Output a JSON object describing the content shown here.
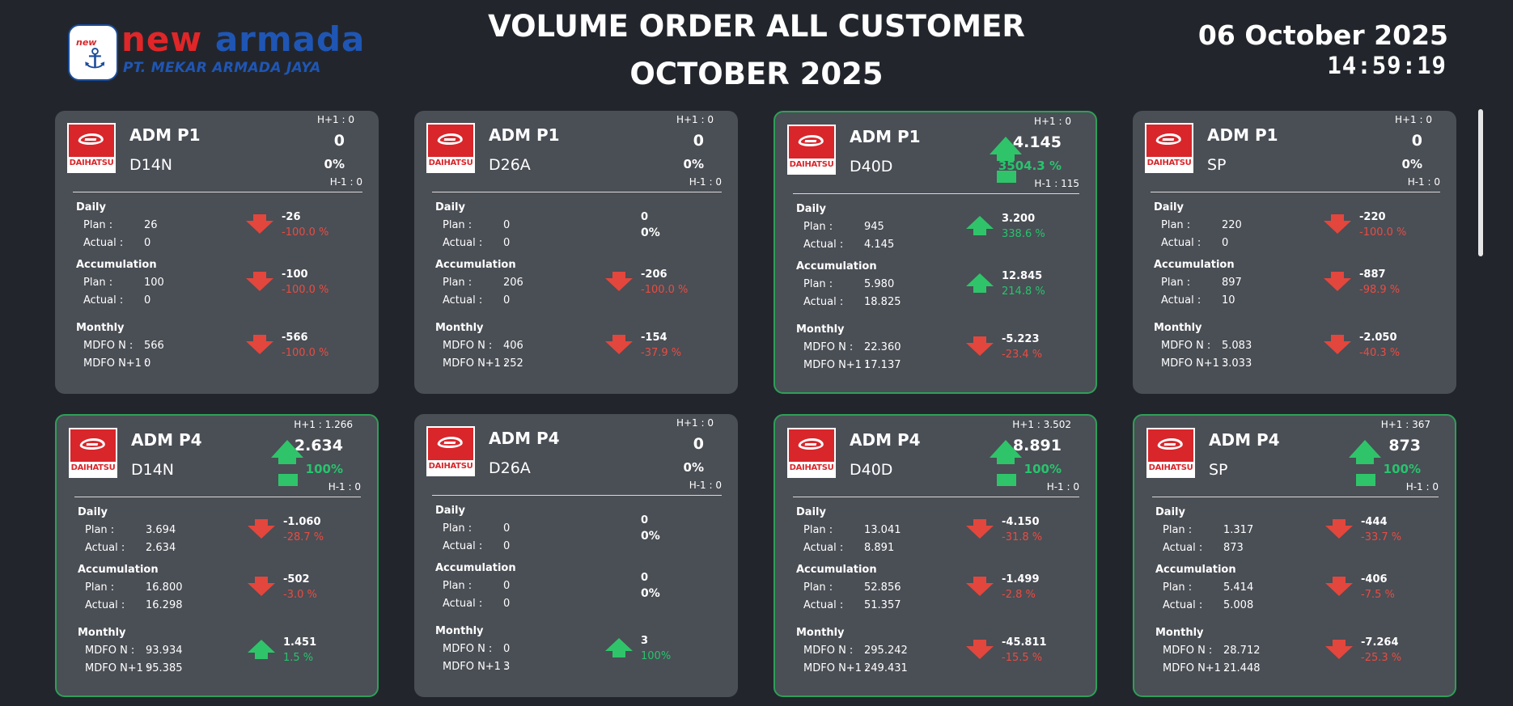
{
  "header": {
    "logo_mini": "new",
    "logo_name_1": "new",
    "logo_name_2": "armada",
    "logo_sub": "PT. MEKAR ARMADA JAYA",
    "title_line1": "VOLUME ORDER ALL CUSTOMER",
    "title_line2": "OCTOBER 2025",
    "date": "06 October 2025",
    "time": "14:59:19"
  },
  "labels": {
    "brand": "DAIHATSU",
    "daily": "Daily",
    "accumulation": "Accumulation",
    "monthly": "Monthly",
    "plan": "Plan :",
    "actual": "Actual :",
    "mdfo_n": "MDFO N :",
    "mdfo_n1": "MDFO N+1 :"
  },
  "colors": {
    "background": "#22262c",
    "card": "#4a4e55",
    "up": "#2fc46a",
    "down": "#e3463c",
    "highlight_border": "#2f9f58"
  },
  "cards": [
    {
      "customer": "ADM P1",
      "part": "D14N",
      "h_plus": "H+1 : 0",
      "h_minus": "H-1 : 0",
      "value": "0",
      "value_pct": "0%",
      "trend": "none",
      "daily": {
        "plan": "26",
        "actual": "0",
        "diff": "-26",
        "pct": "-100.0 %",
        "dir": "down"
      },
      "accum": {
        "plan": "100",
        "actual": "0",
        "diff": "-100",
        "pct": "-100.0 %",
        "dir": "down"
      },
      "monthly": {
        "mdfo_n": "566",
        "mdfo_n1": "0",
        "diff": "-566",
        "pct": "-100.0 %",
        "dir": "down"
      }
    },
    {
      "customer": "ADM P1",
      "part": "D26A",
      "h_plus": "H+1 : 0",
      "h_minus": "H-1 : 0",
      "value": "0",
      "value_pct": "0%",
      "trend": "none",
      "daily": {
        "plan": "0",
        "actual": "0",
        "diff": "0",
        "pct": "0%",
        "dir": "none"
      },
      "accum": {
        "plan": "206",
        "actual": "0",
        "diff": "-206",
        "pct": "-100.0 %",
        "dir": "down"
      },
      "monthly": {
        "mdfo_n": "406",
        "mdfo_n1": "252",
        "diff": "-154",
        "pct": "-37.9 %",
        "dir": "down"
      }
    },
    {
      "customer": "ADM P1",
      "part": "D40D",
      "h_plus": "H+1 : 0",
      "h_minus": "H-1 : 115",
      "value": "4.145",
      "value_pct": "3504.3 %",
      "trend": "up",
      "daily": {
        "plan": "945",
        "actual": "4.145",
        "diff": "3.200",
        "pct": "338.6 %",
        "dir": "up"
      },
      "accum": {
        "plan": "5.980",
        "actual": "18.825",
        "diff": "12.845",
        "pct": "214.8 %",
        "dir": "up"
      },
      "monthly": {
        "mdfo_n": "22.360",
        "mdfo_n1": "17.137",
        "diff": "-5.223",
        "pct": "-23.4 %",
        "dir": "down"
      }
    },
    {
      "customer": "ADM P1",
      "part": "SP",
      "h_plus": "H+1 : 0",
      "h_minus": "H-1 : 0",
      "value": "0",
      "value_pct": "0%",
      "trend": "none",
      "daily": {
        "plan": "220",
        "actual": "0",
        "diff": "-220",
        "pct": "-100.0 %",
        "dir": "down"
      },
      "accum": {
        "plan": "897",
        "actual": "10",
        "diff": "-887",
        "pct": "-98.9 %",
        "dir": "down"
      },
      "monthly": {
        "mdfo_n": "5.083",
        "mdfo_n1": "3.033",
        "diff": "-2.050",
        "pct": "-40.3 %",
        "dir": "down"
      }
    },
    {
      "customer": "ADM P4",
      "part": "D14N",
      "h_plus": "H+1 : 1.266",
      "h_minus": "H-1 : 0",
      "value": "2.634",
      "value_pct": "100%",
      "trend": "up",
      "daily": {
        "plan": "3.694",
        "actual": "2.634",
        "diff": "-1.060",
        "pct": "-28.7 %",
        "dir": "down"
      },
      "accum": {
        "plan": "16.800",
        "actual": "16.298",
        "diff": "-502",
        "pct": "-3.0 %",
        "dir": "down"
      },
      "monthly": {
        "mdfo_n": "93.934",
        "mdfo_n1": "95.385",
        "diff": "1.451",
        "pct": "1.5 %",
        "dir": "up"
      }
    },
    {
      "customer": "ADM P4",
      "part": "D26A",
      "h_plus": "H+1 : 0",
      "h_minus": "H-1 : 0",
      "value": "0",
      "value_pct": "0%",
      "trend": "none",
      "daily": {
        "plan": "0",
        "actual": "0",
        "diff": "0",
        "pct": "0%",
        "dir": "none"
      },
      "accum": {
        "plan": "0",
        "actual": "0",
        "diff": "0",
        "pct": "0%",
        "dir": "none"
      },
      "monthly": {
        "mdfo_n": "0",
        "mdfo_n1": "3",
        "diff": "3",
        "pct": "100%",
        "dir": "up"
      }
    },
    {
      "customer": "ADM P4",
      "part": "D40D",
      "h_plus": "H+1 : 3.502",
      "h_minus": "H-1 : 0",
      "value": "8.891",
      "value_pct": "100%",
      "trend": "up",
      "daily": {
        "plan": "13.041",
        "actual": "8.891",
        "diff": "-4.150",
        "pct": "-31.8 %",
        "dir": "down"
      },
      "accum": {
        "plan": "52.856",
        "actual": "51.357",
        "diff": "-1.499",
        "pct": "-2.8 %",
        "dir": "down"
      },
      "monthly": {
        "mdfo_n": "295.242",
        "mdfo_n1": "249.431",
        "diff": "-45.811",
        "pct": "-15.5 %",
        "dir": "down"
      }
    },
    {
      "customer": "ADM P4",
      "part": "SP",
      "h_plus": "H+1 : 367",
      "h_minus": "H-1 : 0",
      "value": "873",
      "value_pct": "100%",
      "trend": "up",
      "daily": {
        "plan": "1.317",
        "actual": "873",
        "diff": "-444",
        "pct": "-33.7 %",
        "dir": "down"
      },
      "accum": {
        "plan": "5.414",
        "actual": "5.008",
        "diff": "-406",
        "pct": "-7.5 %",
        "dir": "down"
      },
      "monthly": {
        "mdfo_n": "28.712",
        "mdfo_n1": "21.448",
        "diff": "-7.264",
        "pct": "-25.3 %",
        "dir": "down"
      }
    }
  ]
}
